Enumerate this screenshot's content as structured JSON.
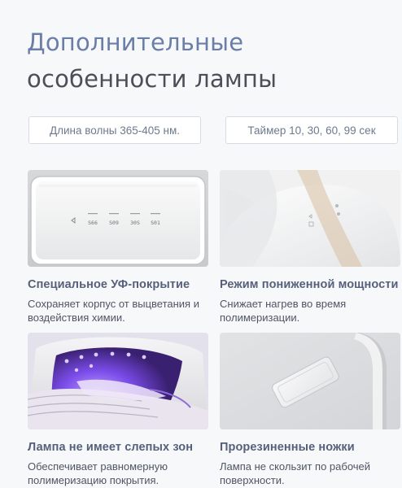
{
  "heading": {
    "line1": "Дополнительные",
    "line2": "особенности лампы"
  },
  "chips": [
    {
      "label": "Длина волны 365-405 нм."
    },
    {
      "label": "Таймер 10, 30, 60, 99 сек"
    }
  ],
  "features": [
    {
      "title": "Специальное УФ-покрытие",
      "description": "Сохраняет корпус от выцветания и воздействия химии.",
      "image_icon": "lamp-control-panel",
      "panel_labels": [
        "S66",
        "S09",
        "30S",
        "S01"
      ]
    },
    {
      "title": "Режим пониженной мощности",
      "description": "Снижает нагрев во время полимеризации.",
      "image_icon": "lamp-dome-closeup"
    },
    {
      "title": "Лампа не имеет слепых зон",
      "description": "Обеспечивает равномерную полимеризацию покрытия.",
      "image_icon": "hand-under-uv-lamp"
    },
    {
      "title": "Прорезиненные ножки",
      "description": "Лампа не скользит по рабочей поверхности.",
      "image_icon": "rubber-foot-closeup"
    }
  ],
  "colors": {
    "heading_accent": "#6a7ea8",
    "heading_dark": "#4b4f57",
    "uv_purple": "#8a5cf0",
    "background": "#f7f8fa"
  }
}
